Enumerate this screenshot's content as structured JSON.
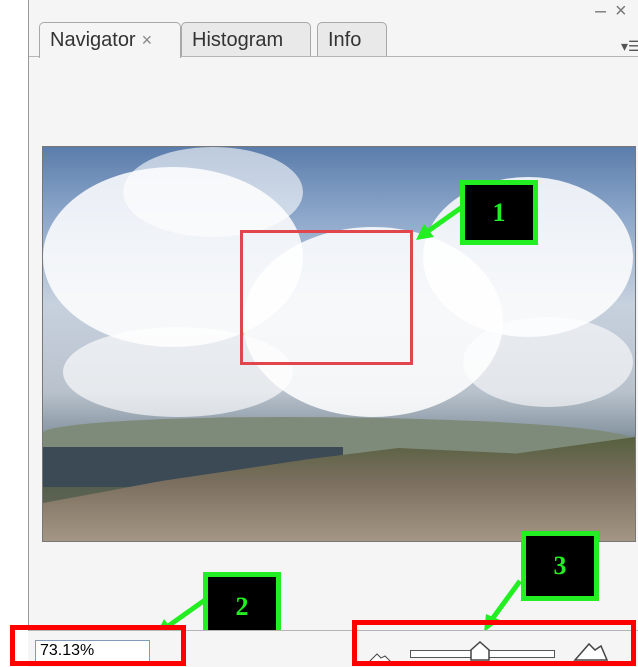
{
  "tabs": [
    {
      "label": "Navigator",
      "close": "×",
      "active": true
    },
    {
      "label": "Histogram",
      "active": false
    },
    {
      "label": "Info",
      "active": false
    }
  ],
  "window_controls": {
    "minimize": "–",
    "close": "×"
  },
  "panel_menu_icon": "panel-menu-icon",
  "zoom": {
    "value": "73.13%"
  },
  "slider": {
    "level": 0.48
  },
  "callouts": [
    "1",
    "2",
    "3"
  ],
  "colors": {
    "viewbox": "#e0464c",
    "callout_border": "#22ee22",
    "highlight": "#ff0000"
  }
}
